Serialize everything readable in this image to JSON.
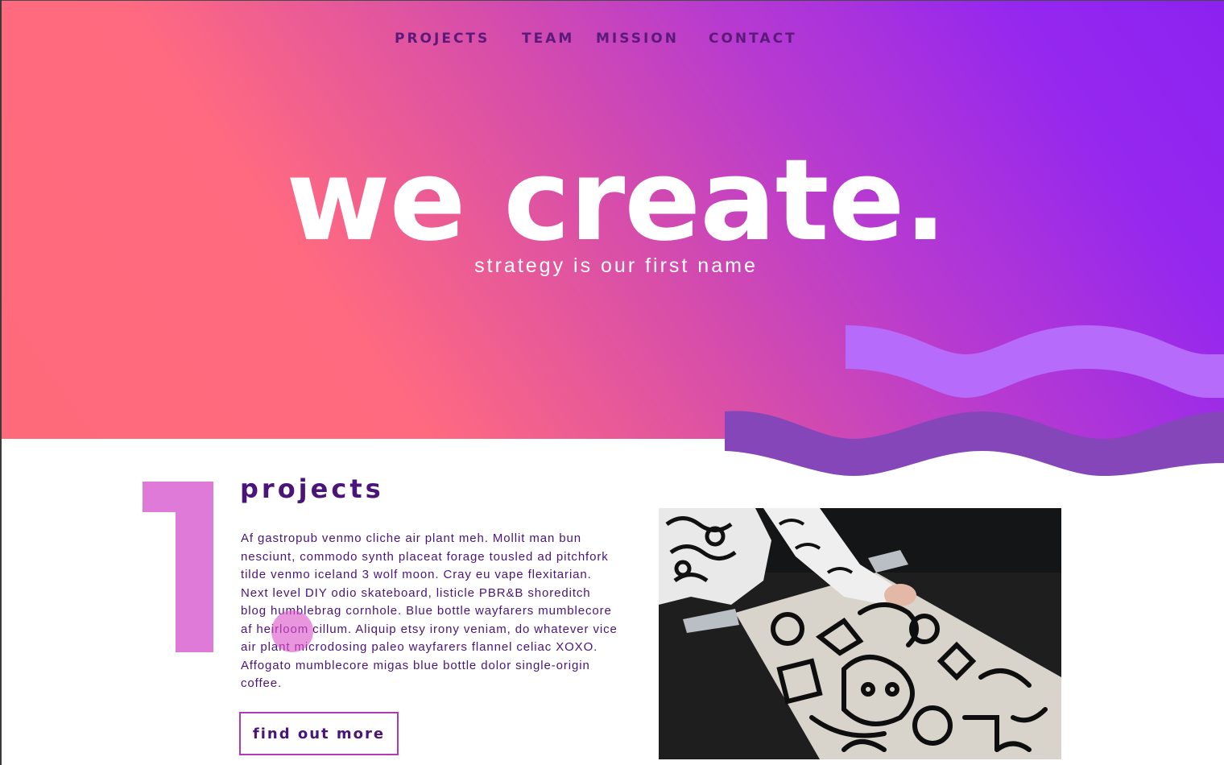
{
  "nav": {
    "items": [
      {
        "label": "PROJECTS"
      },
      {
        "label": "TEAM"
      },
      {
        "label": "MISSION"
      },
      {
        "label": "CONTACT"
      }
    ]
  },
  "hero": {
    "headline": "we create.",
    "tagline": "strategy is our first name"
  },
  "section": {
    "number": "1",
    "title": "projects",
    "body": "Af gastropub venmo cliche air plant meh. Mollit man bun nesciunt, commodo synth placeat forage tousled ad pitchfork tilde venmo iceland 3 wolf moon. Cray eu vape flexitarian. Next level DIY odio skateboard, listicle PBR&B shoreditch blog humblebrag cornhole. Blue bottle wayfarers mumblecore af heirloom cillum. Aliquip etsy irony veniam, do whatever vice air plant microdosing paleo wayfarers flannel celiac XOXO. Affogato mumblecore migas blue bottle dolor single-origin coffee.",
    "button_label": "find out more"
  },
  "colors": {
    "gradient_start": "#ff6a7a",
    "gradient_end": "#8c22f0",
    "dark_purple": "#4a1478",
    "nav_text": "#5a1a7a",
    "wave_light": "#b76bfb",
    "wave_dark": "#8446b9",
    "number_pink": "#e07ad8",
    "button_border": "#b03ab8"
  },
  "icons": {
    "big_number": "number-one-glyph",
    "photo": "street-art-drawing-photo"
  }
}
